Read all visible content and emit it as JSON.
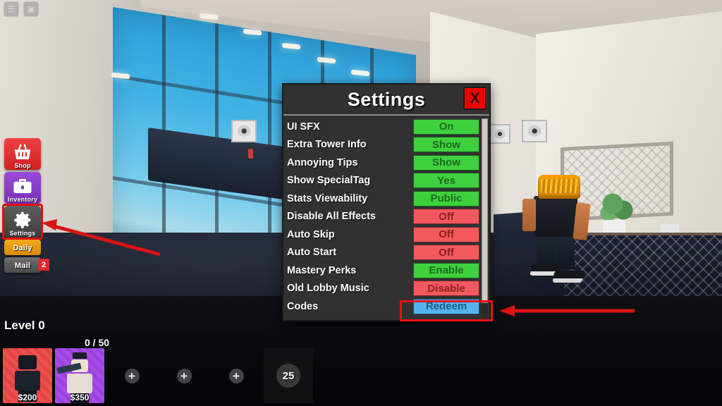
{
  "game": {
    "top_icons": [
      {
        "name": "roblox-menu-icon",
        "glyph": "☰"
      },
      {
        "name": "roblox-chat-icon",
        "glyph": "▣"
      }
    ]
  },
  "sidebar": {
    "items": [
      {
        "id": "shop",
        "label": "Shop",
        "icon": "shopping-basket-icon"
      },
      {
        "id": "inventory",
        "label": "Inventory",
        "icon": "briefcase-icon"
      },
      {
        "id": "settings",
        "label": "Settings",
        "icon": "gear-icon",
        "highlighted": true
      },
      {
        "id": "daily",
        "label": "Daily",
        "icon": "calendar-icon"
      },
      {
        "id": "mail",
        "label": "Mail",
        "icon": "envelope-icon",
        "badge": "2"
      }
    ]
  },
  "settings_panel": {
    "title": "Settings",
    "close_label": "X",
    "rows": [
      {
        "label": "UI SFX",
        "value": "On",
        "state": "green"
      },
      {
        "label": "Extra Tower Info",
        "value": "Show",
        "state": "green"
      },
      {
        "label": "Annoying Tips",
        "value": "Show",
        "state": "green"
      },
      {
        "label": "Show SpecialTag",
        "value": "Yes",
        "state": "green"
      },
      {
        "label": "Stats Viewability",
        "value": "Public",
        "state": "green"
      },
      {
        "label": "Disable All Effects",
        "value": "Off",
        "state": "red"
      },
      {
        "label": "Auto Skip",
        "value": "Off",
        "state": "red"
      },
      {
        "label": "Auto Start",
        "value": "Off",
        "state": "red"
      },
      {
        "label": "Mastery Perks",
        "value": "Enable",
        "state": "green"
      },
      {
        "label": "Old Lobby Music",
        "value": "Disable",
        "state": "red"
      },
      {
        "label": "Codes",
        "value": "Redeem",
        "state": "blue"
      }
    ]
  },
  "hud": {
    "level": "Level 0",
    "xp": "0 / 50",
    "towers": [
      {
        "price": "$200",
        "color": "red"
      },
      {
        "price": "$350",
        "color": "purple"
      }
    ],
    "empty_slot_glyph": "+",
    "empty_slots": 3,
    "coin_value": "25"
  },
  "annotations": {
    "arrow_to_settings": "arrow pointing to Settings button",
    "arrow_to_redeem": "arrow pointing to Redeem button",
    "highlight_color": "#ec1010"
  }
}
